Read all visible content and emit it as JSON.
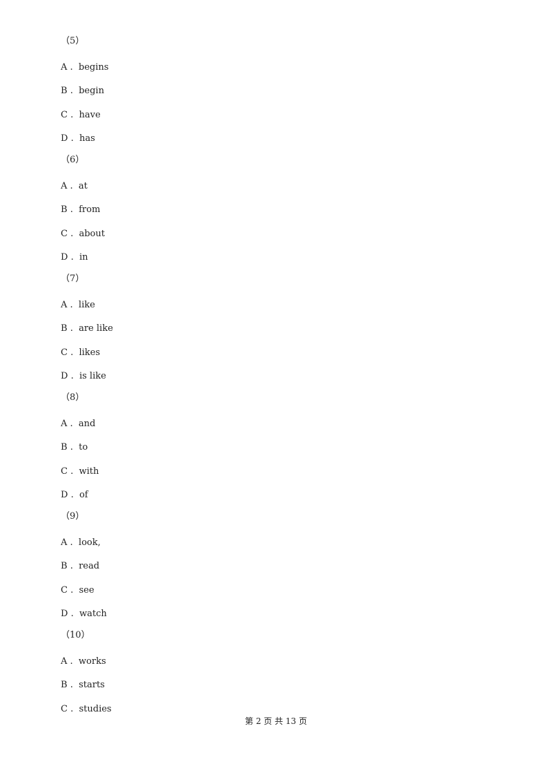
{
  "questions": [
    {
      "number": "（5）",
      "options": [
        {
          "letter": "A",
          "text": "begins"
        },
        {
          "letter": "B",
          "text": "begin"
        },
        {
          "letter": "C",
          "text": "have"
        },
        {
          "letter": "D",
          "text": "has"
        }
      ]
    },
    {
      "number": "（6）",
      "options": [
        {
          "letter": "A",
          "text": "at"
        },
        {
          "letter": "B",
          "text": "from"
        },
        {
          "letter": "C",
          "text": "about"
        },
        {
          "letter": "D",
          "text": "in"
        }
      ]
    },
    {
      "number": "（7）",
      "options": [
        {
          "letter": "A",
          "text": "like"
        },
        {
          "letter": "B",
          "text": "are like"
        },
        {
          "letter": "C",
          "text": "likes"
        },
        {
          "letter": "D",
          "text": "is like"
        }
      ]
    },
    {
      "number": "（8）",
      "options": [
        {
          "letter": "A",
          "text": "and"
        },
        {
          "letter": "B",
          "text": "to"
        },
        {
          "letter": "C",
          "text": "with"
        },
        {
          "letter": "D",
          "text": "of"
        }
      ]
    },
    {
      "number": "（9）",
      "options": [
        {
          "letter": "A",
          "text": "look,"
        },
        {
          "letter": "B",
          "text": "read"
        },
        {
          "letter": "C",
          "text": "see"
        },
        {
          "letter": "D",
          "text": "watch"
        }
      ]
    },
    {
      "number": "（10）",
      "options": [
        {
          "letter": "A",
          "text": "works"
        },
        {
          "letter": "B",
          "text": "starts"
        },
        {
          "letter": "C",
          "text": "studies"
        }
      ]
    }
  ],
  "footer": "第 2 页 共 13 页"
}
